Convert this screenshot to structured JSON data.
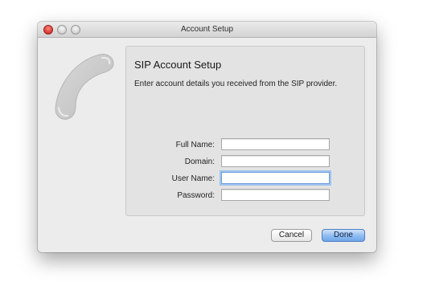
{
  "window": {
    "title": "Account Setup"
  },
  "icons": {
    "close": "close-icon",
    "minimize": "minimize-icon",
    "zoom": "zoom-icon",
    "phone": "phone-handset-icon"
  },
  "panel": {
    "title": "SIP Account Setup",
    "description": "Enter account details you received from the SIP provider."
  },
  "form": {
    "full_name": {
      "label": "Full Name:",
      "value": ""
    },
    "domain": {
      "label": "Domain:",
      "value": ""
    },
    "user_name": {
      "label": "User Name:",
      "value": ""
    },
    "password": {
      "label": "Password:",
      "value": ""
    }
  },
  "buttons": {
    "cancel": "Cancel",
    "done": "Done"
  },
  "colors": {
    "accent": "#6fa6ea",
    "focus_ring": "#9fc3ef",
    "close_button": "#e0443e"
  }
}
